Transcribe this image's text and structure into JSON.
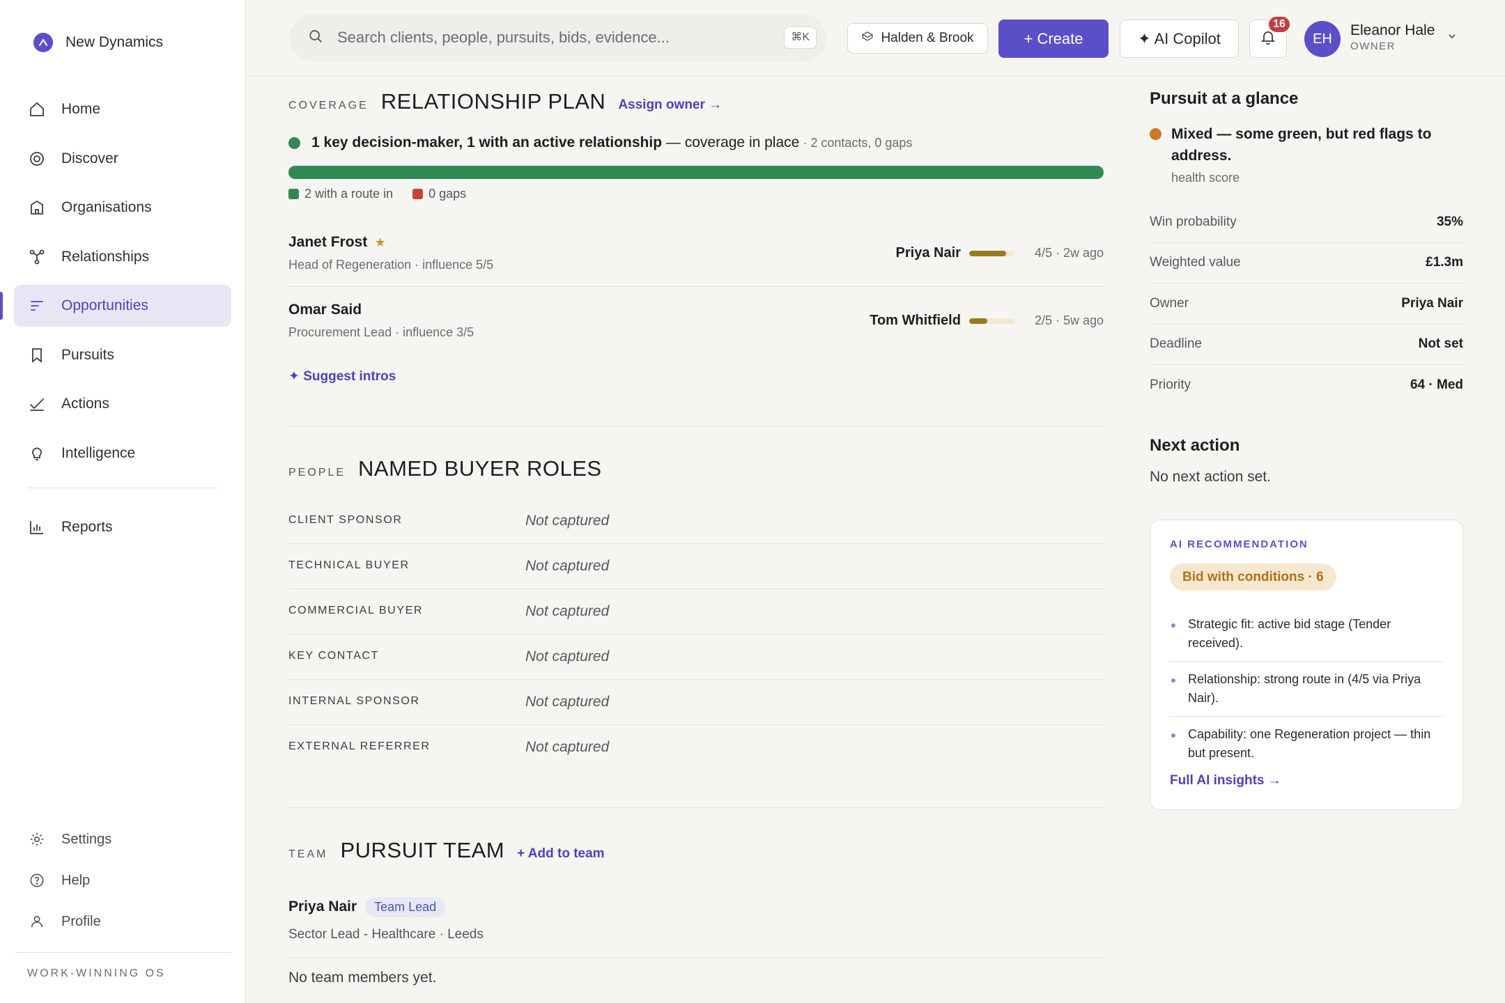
{
  "app": {
    "brand": "New Dynamics",
    "footer": "WORK-WINNING OS"
  },
  "nav": {
    "items": [
      {
        "label": "Home",
        "icon": "home-icon"
      },
      {
        "label": "Discover",
        "icon": "target-icon"
      },
      {
        "label": "Organisations",
        "icon": "building-icon"
      },
      {
        "label": "Relationships",
        "icon": "network-icon"
      },
      {
        "label": "Opportunities",
        "icon": "bars-icon",
        "active": true
      },
      {
        "label": "Pursuits",
        "icon": "bookmark-icon"
      },
      {
        "label": "Actions",
        "icon": "check-icon"
      },
      {
        "label": "Intelligence",
        "icon": "bulb-icon"
      },
      {
        "label": "Reports",
        "icon": "chart-icon"
      }
    ],
    "bottom": [
      {
        "label": "Settings",
        "icon": "gear-icon"
      },
      {
        "label": "Help",
        "icon": "help-icon"
      },
      {
        "label": "Profile",
        "icon": "user-icon"
      }
    ]
  },
  "topbar": {
    "search_placeholder": "Search clients, people, pursuits, bids, evidence...",
    "shortcut": "⌘K",
    "org": "Halden & Brook",
    "create": "+ Create",
    "copilot": "✦ AI Copilot",
    "notifications": "16",
    "user": {
      "initials": "EH",
      "name": "Eleanor Hale",
      "role": "OWNER"
    }
  },
  "coverage": {
    "eyebrow": "COVERAGE",
    "title": "RELATIONSHIP PLAN",
    "assign": "Assign owner →",
    "summary_bold": "1 key decision-maker, 1 with an active relationship",
    "summary_rest": " — coverage in place",
    "summary_meta": " · 2 contacts, 0 gaps",
    "coverage_fraction": 1.0,
    "legend_route": "2 with a route in",
    "legend_gaps": "0 gaps",
    "colors": {
      "good": "#2f8a52",
      "gap": "#c8423a",
      "strength": "#9a7b1c"
    },
    "contacts": [
      {
        "name": "Janet Frost",
        "star": "★",
        "role": "Head of Regeneration · influence 5/5",
        "via": "Priya Nair",
        "strength": 0.8,
        "meta": "4/5 · 2w ago"
      },
      {
        "name": "Omar Said",
        "star": "",
        "role": "Procurement Lead · influence 3/5",
        "via": "Tom Whitfield",
        "strength": 0.4,
        "meta": "2/5 · 5w ago"
      }
    ],
    "suggest": "✦ Suggest intros"
  },
  "people": {
    "eyebrow": "PEOPLE",
    "title": "NAMED BUYER ROLES",
    "roles": [
      {
        "role": "CLIENT SPONSOR",
        "value": "Not captured"
      },
      {
        "role": "TECHNICAL BUYER",
        "value": "Not captured"
      },
      {
        "role": "COMMERCIAL BUYER",
        "value": "Not captured"
      },
      {
        "role": "KEY CONTACT",
        "value": "Not captured"
      },
      {
        "role": "INTERNAL SPONSOR",
        "value": "Not captured"
      },
      {
        "role": "EXTERNAL REFERRER",
        "value": "Not captured"
      }
    ]
  },
  "team": {
    "eyebrow": "TEAM",
    "title": "PURSUIT TEAM",
    "add": "+ Add to team",
    "member": {
      "name": "Priya Nair",
      "badge": "Team Lead",
      "sub": "Sector Lead - Healthcare · Leeds"
    },
    "empty": "No team members yet."
  },
  "glance": {
    "title": "Pursuit at a glance",
    "health_text": "Mixed — some green, but red flags to address.",
    "health_label": "health score",
    "health_color": "#c97a22",
    "rows": [
      {
        "k": "Win probability",
        "v": "35%"
      },
      {
        "k": "Weighted value",
        "v": "£1.3m"
      },
      {
        "k": "Owner",
        "v": "Priya Nair"
      },
      {
        "k": "Deadline",
        "v": "Not set"
      },
      {
        "k": "Priority",
        "v": "64 · Med"
      }
    ],
    "next_title": "Next action",
    "next_text": "No next action set."
  },
  "ai": {
    "eyebrow": "AI RECOMMENDATION",
    "badge": "Bid with conditions · 6",
    "points": [
      "Strategic fit: active bid stage (Tender received).",
      "Relationship: strong route in (4/5 via Priya Nair).",
      "Capability: one Regeneration project — thin but present."
    ],
    "link": "Full AI insights →"
  }
}
